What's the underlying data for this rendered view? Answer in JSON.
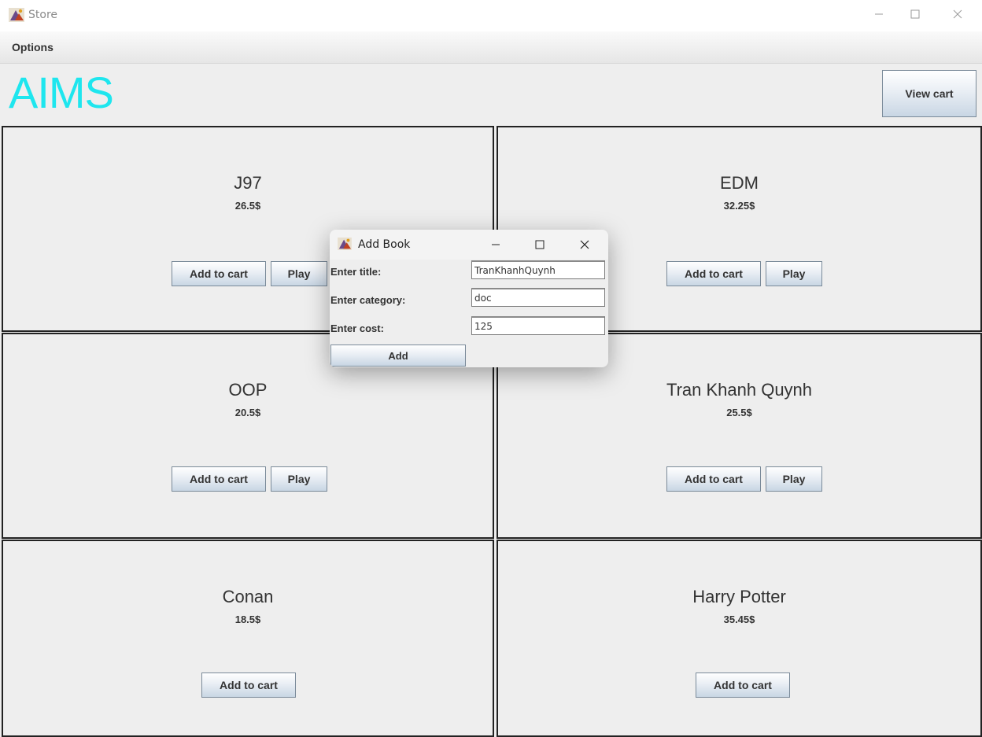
{
  "window": {
    "title": "Store"
  },
  "menubar": {
    "options_label": "Options"
  },
  "header": {
    "logo": "AIMS",
    "view_cart_label": "View cart",
    "logo_color": "#1ee6ee"
  },
  "products": [
    {
      "name": "J97",
      "price": "26.5$",
      "add_label": "Add to cart",
      "play_label": "Play"
    },
    {
      "name": "EDM",
      "price": "32.25$",
      "add_label": "Add to cart",
      "play_label": "Play"
    },
    {
      "name": "OOP",
      "price": "20.5$",
      "add_label": "Add to cart",
      "play_label": "Play"
    },
    {
      "name": "Tran Khanh Quynh",
      "price": "25.5$",
      "add_label": "Add to cart",
      "play_label": "Play"
    },
    {
      "name": "Conan",
      "price": "18.5$",
      "add_label": "Add to cart"
    },
    {
      "name": "Harry Potter",
      "price": "35.45$",
      "add_label": "Add to cart"
    }
  ],
  "dialog": {
    "title": "Add Book",
    "title_label": "Enter title:",
    "title_value": "TranKhanhQuynh",
    "category_label": "Enter category:",
    "category_value": "doc",
    "cost_label": "Enter cost:",
    "cost_value": "125",
    "add_label": "Add"
  }
}
